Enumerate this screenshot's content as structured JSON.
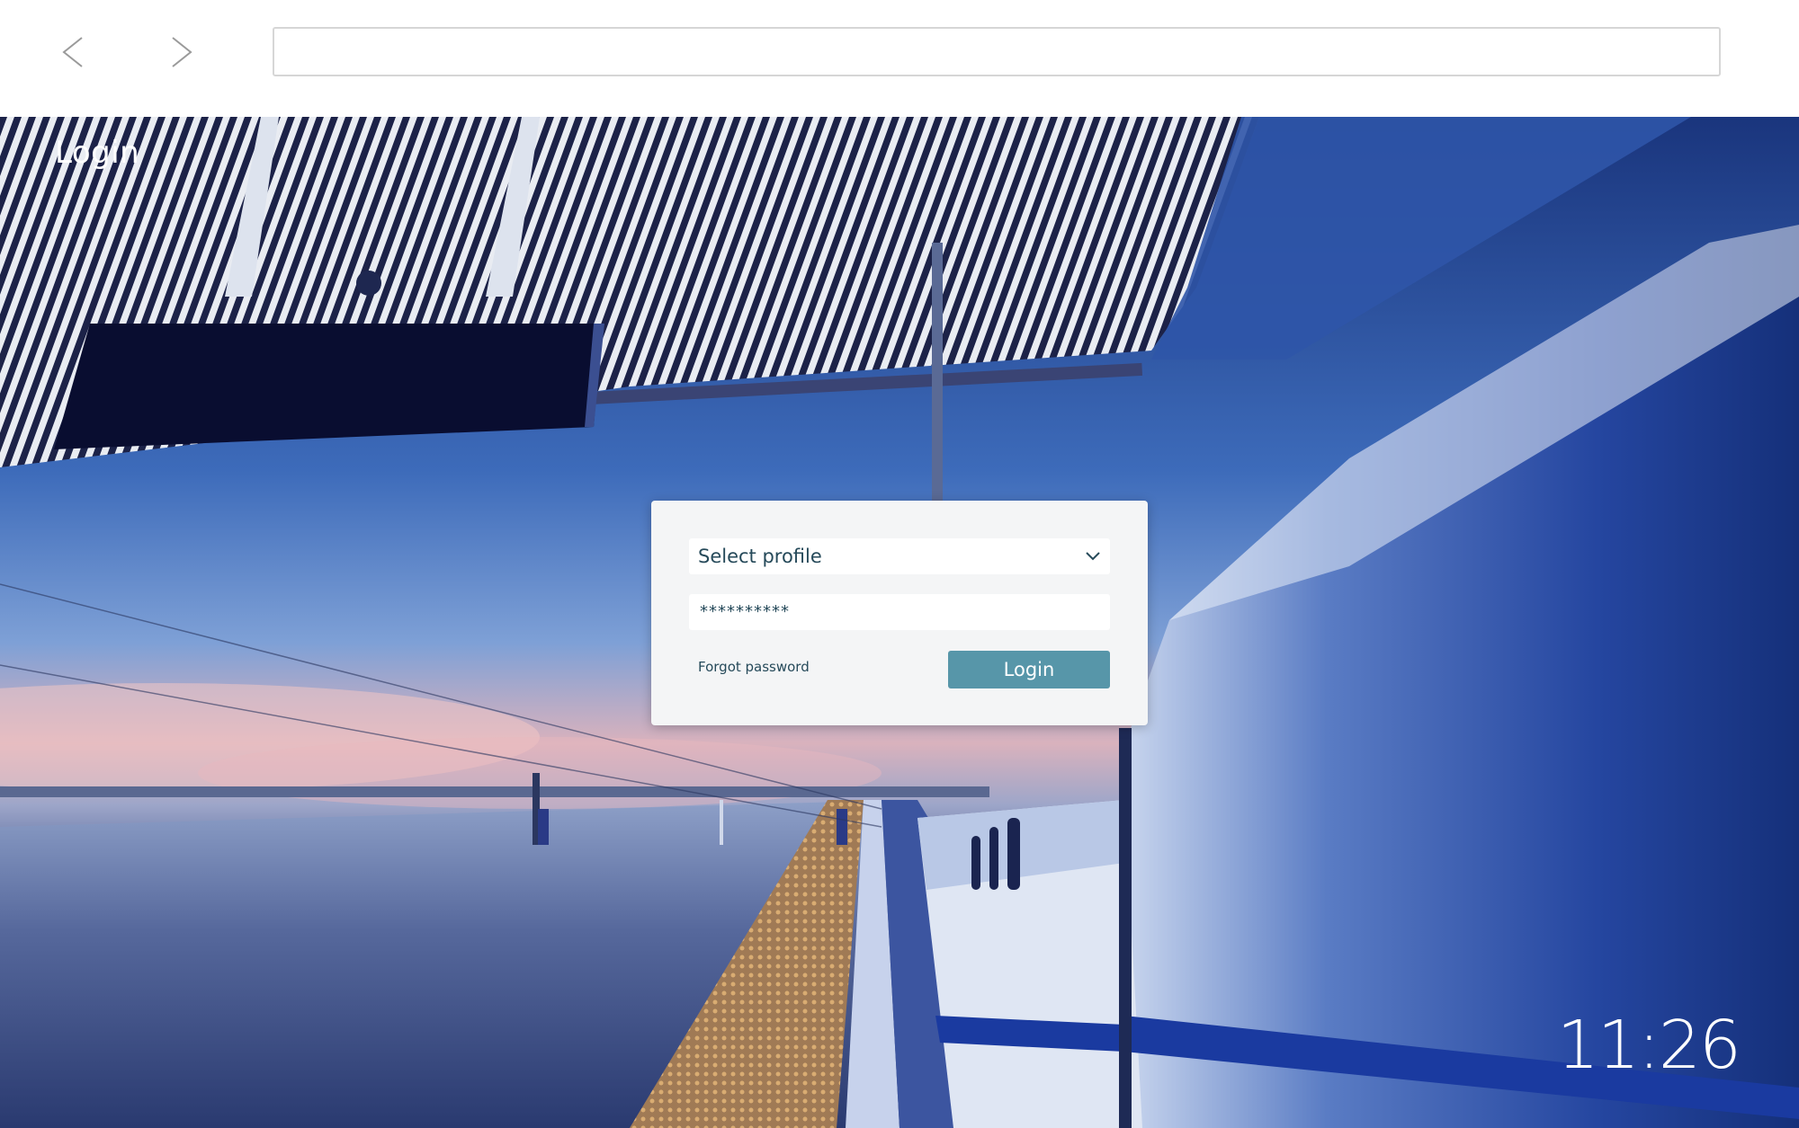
{
  "browser": {
    "back_icon": "chevron-left-icon",
    "forward_icon": "chevron-right-icon",
    "address_value": ""
  },
  "page": {
    "title": "Login",
    "clock": "11:26"
  },
  "login_form": {
    "profile_select": {
      "selected": "Select profile",
      "icon": "chevron-down-icon"
    },
    "password": {
      "value": "**********"
    },
    "forgot_label": "Forgot password",
    "submit_label": "Login"
  },
  "colors": {
    "accent": "#5796a9",
    "text": "#264a5a",
    "card": "#f4f5f6"
  }
}
